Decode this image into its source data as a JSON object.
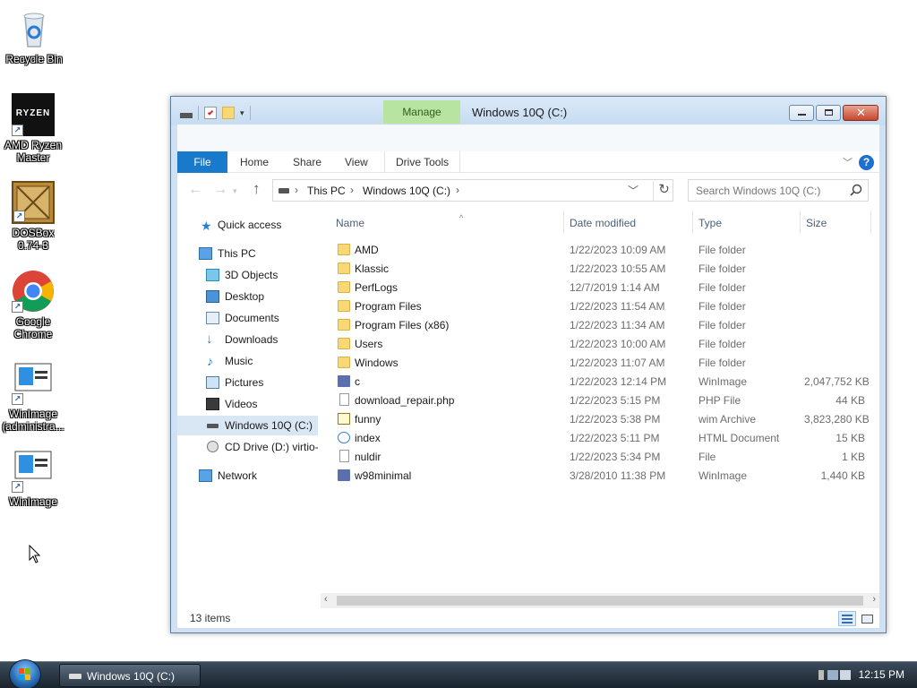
{
  "desktop": {
    "icons": [
      {
        "label": "Recycle Bin"
      },
      {
        "label": "AMD Ryzen Master",
        "logo_text": "RYZEN"
      },
      {
        "label": "DOSBox 0.74-3"
      },
      {
        "label": "Google Chrome"
      },
      {
        "label": "WinImage (administra..."
      },
      {
        "label": "WinImage"
      }
    ]
  },
  "window": {
    "title": "Windows 10Q (C:)",
    "manage_tab": "Manage",
    "ribbon_tabs": {
      "file": "File",
      "home": "Home",
      "share": "Share",
      "view": "View",
      "drive_tools": "Drive Tools"
    },
    "help_label": "?",
    "address": {
      "crumbs": [
        "This PC",
        "Windows 10Q (C:)"
      ]
    },
    "search": {
      "placeholder": "Search Windows 10Q (C:)"
    },
    "nav_pane": {
      "items": [
        {
          "label": "Quick access",
          "icon": "star-icon"
        },
        {
          "label": "This PC",
          "icon": "computer-icon"
        },
        {
          "label": "3D Objects",
          "icon": "cube-icon"
        },
        {
          "label": "Desktop",
          "icon": "desktop-icon"
        },
        {
          "label": "Documents",
          "icon": "documents-icon"
        },
        {
          "label": "Downloads",
          "icon": "download-arrow-icon"
        },
        {
          "label": "Music",
          "icon": "music-note-icon"
        },
        {
          "label": "Pictures",
          "icon": "pictures-icon"
        },
        {
          "label": "Videos",
          "icon": "film-icon"
        },
        {
          "label": "Windows 10Q (C:)",
          "icon": "drive-icon",
          "selected": true
        },
        {
          "label": "CD Drive (D:) virtio-",
          "icon": "cd-drive-icon"
        },
        {
          "label": "Network",
          "icon": "network-icon"
        }
      ]
    },
    "columns": {
      "name": "Name",
      "date": "Date modified",
      "type": "Type",
      "size": "Size"
    },
    "files": [
      {
        "name": "AMD",
        "date": "1/22/2023 10:09 AM",
        "type": "File folder",
        "size": "",
        "icon": "folder-icon"
      },
      {
        "name": "Klassic",
        "date": "1/22/2023 10:55 AM",
        "type": "File folder",
        "size": "",
        "icon": "folder-icon"
      },
      {
        "name": "PerfLogs",
        "date": "12/7/2019 1:14 AM",
        "type": "File folder",
        "size": "",
        "icon": "folder-icon"
      },
      {
        "name": "Program Files",
        "date": "1/22/2023 11:54 AM",
        "type": "File folder",
        "size": "",
        "icon": "folder-icon"
      },
      {
        "name": "Program Files (x86)",
        "date": "1/22/2023 11:34 AM",
        "type": "File folder",
        "size": "",
        "icon": "folder-icon"
      },
      {
        "name": "Users",
        "date": "1/22/2023 10:00 AM",
        "type": "File folder",
        "size": "",
        "icon": "folder-icon"
      },
      {
        "name": "Windows",
        "date": "1/22/2023 11:07 AM",
        "type": "File folder",
        "size": "",
        "icon": "folder-icon"
      },
      {
        "name": "c",
        "date": "1/22/2023 12:14 PM",
        "type": "WinImage",
        "size": "2,047,752 KB",
        "icon": "floppy-icon"
      },
      {
        "name": "download_repair.php",
        "date": "1/22/2023 5:15 PM",
        "type": "PHP File",
        "size": "44 KB",
        "icon": "file-icon"
      },
      {
        "name": "funny",
        "date": "1/22/2023 5:38 PM",
        "type": "wim Archive",
        "size": "3,823,280 KB",
        "icon": "wim-archive-icon"
      },
      {
        "name": "index",
        "date": "1/22/2023 5:11 PM",
        "type": "HTML Document",
        "size": "15 KB",
        "icon": "html-document-icon"
      },
      {
        "name": "nuldir",
        "date": "1/22/2023 5:34 PM",
        "type": "File",
        "size": "1 KB",
        "icon": "file-icon"
      },
      {
        "name": "w98minimal",
        "date": "3/28/2010 11:38 PM",
        "type": "WinImage",
        "size": "1,440 KB",
        "icon": "floppy-icon"
      }
    ],
    "status": {
      "item_count": "13 items"
    }
  },
  "taskbar": {
    "window_button": "Windows 10Q (C:)",
    "clock": "12:15 PM"
  },
  "colors": {
    "accent": "#1979ca",
    "manage_tab": "#b7e4a0",
    "window_frame": "#cfe1f3",
    "selected_row": "#d9e6f4"
  }
}
